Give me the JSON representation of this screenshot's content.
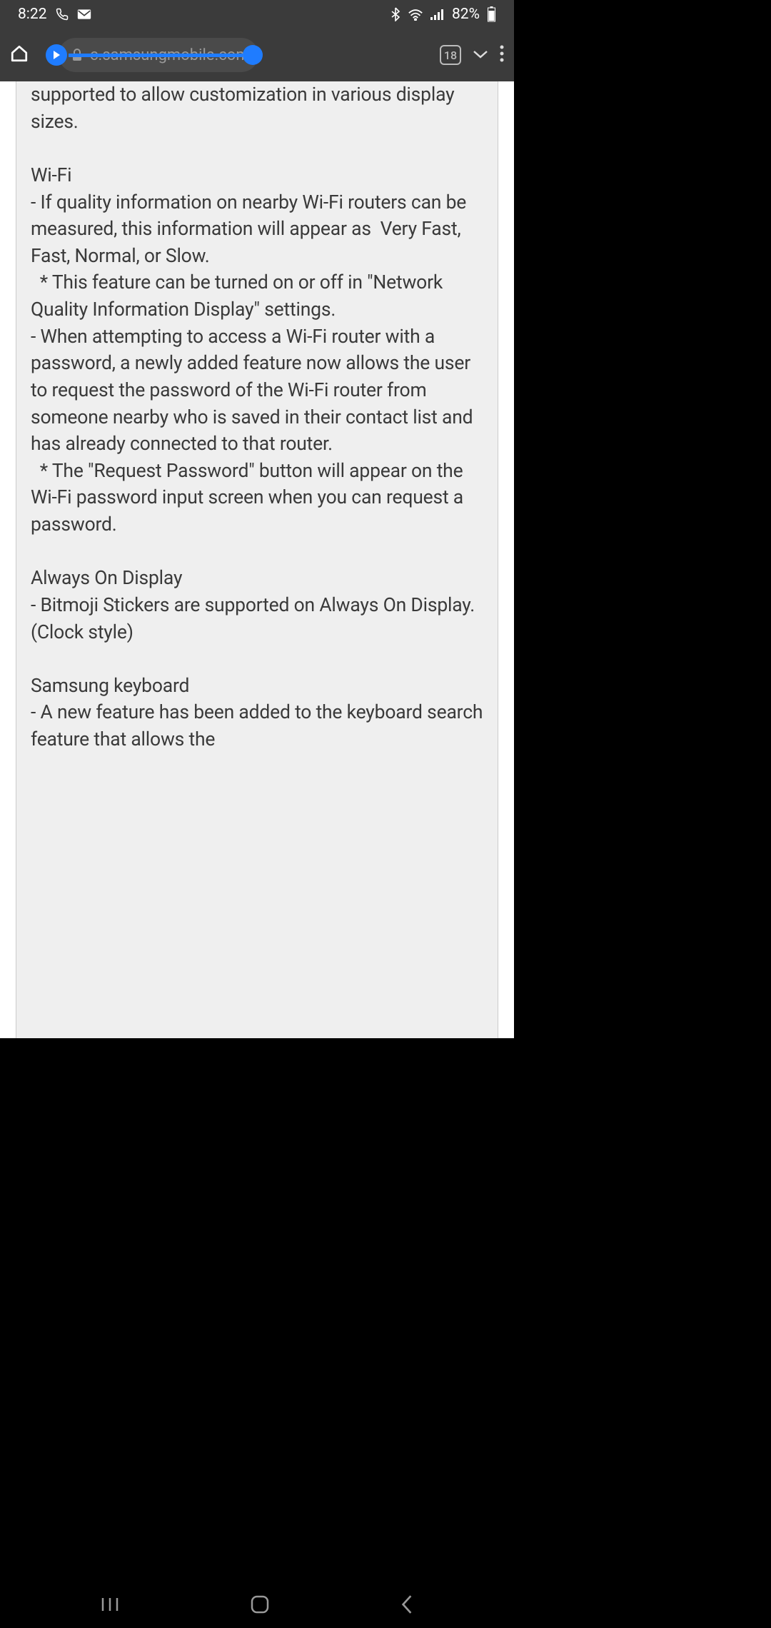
{
  "status": {
    "time": "8:22",
    "battery": "82%"
  },
  "toolbar": {
    "url": "c.samsungmobile.com",
    "tab_count": "18"
  },
  "content": {
    "line1": "supported to allow customization in various display sizes.",
    "wifi_heading": "Wi-Fi",
    "wifi_body": "- If quality information on nearby Wi-Fi routers can be measured, this information will appear as  Very Fast, Fast, Normal, or Slow.\n  * This feature can be turned on or off in \"Network Quality Information Display\" settings.\n- When attempting to access a Wi-Fi router with a password, a newly added feature now allows the user to request the password of the Wi-Fi router from someone nearby who is saved in their contact list and has already connected to that router.\n  * The \"Request Password\" button will appear on the Wi-Fi password input screen when you can request a password.",
    "aod_heading": "Always On Display",
    "aod_body": "- Bitmoji Stickers are supported on Always On Display. (Clock style)",
    "kbd_heading": "Samsung keyboard",
    "kbd_body": "- A new feature has been added to the keyboard search feature that allows the"
  }
}
